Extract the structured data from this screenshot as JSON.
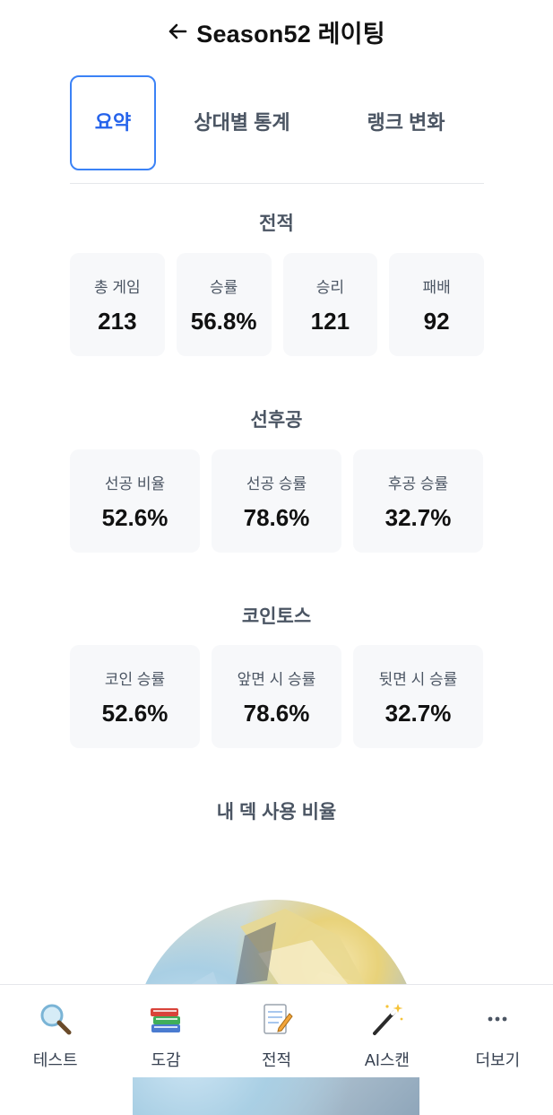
{
  "header": {
    "back_icon": "arrow-left-icon",
    "title": "Season52 레이팅"
  },
  "tabs": [
    {
      "label": "요약",
      "active": true
    },
    {
      "label": "상대별 통계",
      "active": false
    },
    {
      "label": "랭크 변화",
      "active": false
    }
  ],
  "record": {
    "title": "전적",
    "cards": [
      {
        "label": "총 게임",
        "value": "213"
      },
      {
        "label": "승률",
        "value": "56.8%"
      },
      {
        "label": "승리",
        "value": "121"
      },
      {
        "label": "패배",
        "value": "92"
      }
    ]
  },
  "turn_order": {
    "title": "선후공",
    "cards": [
      {
        "label": "선공 비율",
        "value": "52.6%"
      },
      {
        "label": "선공 승률",
        "value": "78.6%"
      },
      {
        "label": "후공 승률",
        "value": "32.7%"
      }
    ]
  },
  "coin_toss": {
    "title": "코인토스",
    "cards": [
      {
        "label": "코인 승률",
        "value": "52.6%"
      },
      {
        "label": "앞면 시 승률",
        "value": "78.6%"
      },
      {
        "label": "뒷면 시 승률",
        "value": "32.7%"
      }
    ]
  },
  "deck_usage": {
    "title": "내 덱 사용 비율"
  },
  "bottom_nav": [
    {
      "label": "테스트",
      "icon": "magnifier-icon"
    },
    {
      "label": "도감",
      "icon": "books-icon"
    },
    {
      "label": "전적",
      "icon": "memo-icon"
    },
    {
      "label": "AI스캔",
      "icon": "magic-wand-icon"
    },
    {
      "label": "더보기",
      "icon": "more-dots-icon"
    }
  ],
  "colors": {
    "accent": "#2563eb",
    "card_bg": "#f7f8fa",
    "divider": "#e5e7eb"
  }
}
